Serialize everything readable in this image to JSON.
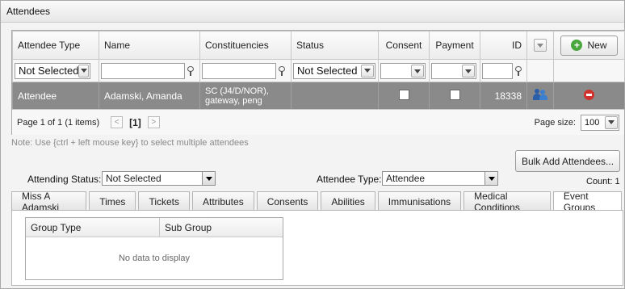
{
  "panel": {
    "title": "Attendees"
  },
  "grid": {
    "columns": [
      "Attendee Type",
      "Name",
      "Constituencies",
      "Status",
      "Consent",
      "Payment",
      "ID"
    ],
    "new_label": "New",
    "filters": {
      "attendee_type": "Not Selected",
      "status": "Not Selected"
    },
    "row": {
      "attendee_type": "Attendee",
      "name": "Adamski, Amanda",
      "constituencies_line1": "SC (J4/D/NOR),",
      "constituencies_line2": "gateway, peng",
      "status": "",
      "id": "18338"
    },
    "pager": {
      "summary": "Page 1 of 1 (1 items)",
      "prev": "<",
      "current": "[1]",
      "next": ">",
      "page_size_label": "Page size:",
      "page_size": "100"
    }
  },
  "note": "Note: Use {ctrl + left mouse key} to select multiple attendees",
  "bulk_add_label": "Bulk Add Attendees...",
  "attending_status": {
    "label": "Attending Status:",
    "value": "Not Selected"
  },
  "attendee_type": {
    "label": "Attendee Type:",
    "value": "Attendee"
  },
  "count_label": "Count: 1",
  "tabs": [
    "Miss A Adamski",
    "Times",
    "Tickets",
    "Attributes",
    "Consents",
    "Abilities",
    "Immunisations",
    "Medical Conditions",
    "Event Groups"
  ],
  "event_groups": {
    "columns": [
      "Group Type",
      "Sub Group"
    ],
    "empty": "No data to display"
  }
}
